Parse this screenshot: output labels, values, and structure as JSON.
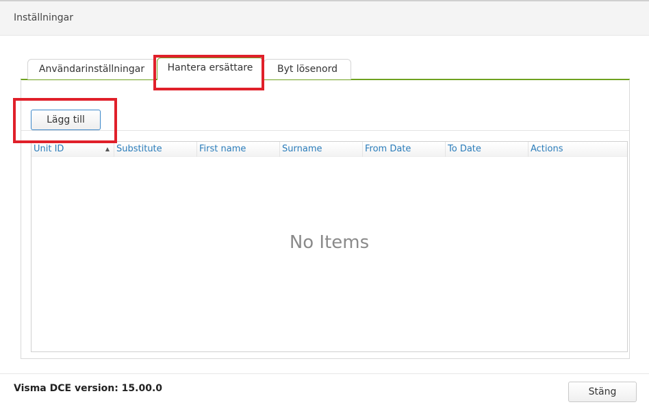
{
  "header": {
    "title": "Inställningar"
  },
  "tabs": [
    {
      "label": "Användarinställningar",
      "active": false
    },
    {
      "label": "Hantera ersättare",
      "active": true
    },
    {
      "label": "Byt lösenord",
      "active": false
    }
  ],
  "toolbar": {
    "add_label": "Lägg till"
  },
  "grid": {
    "columns": [
      "Unit ID",
      "Substitute",
      "First name",
      "Surname",
      "From Date",
      "To Date",
      "Actions"
    ],
    "sorted_column": "Unit ID",
    "sort_direction": "ascending",
    "empty_text": "No Items"
  },
  "footer": {
    "version": "Visma DCE version: 15.00.0",
    "close_label": "Stäng"
  },
  "colors": {
    "accent_green": "#6ea11f",
    "link_blue": "#2a7cba",
    "highlight_red": "#e0202a"
  }
}
